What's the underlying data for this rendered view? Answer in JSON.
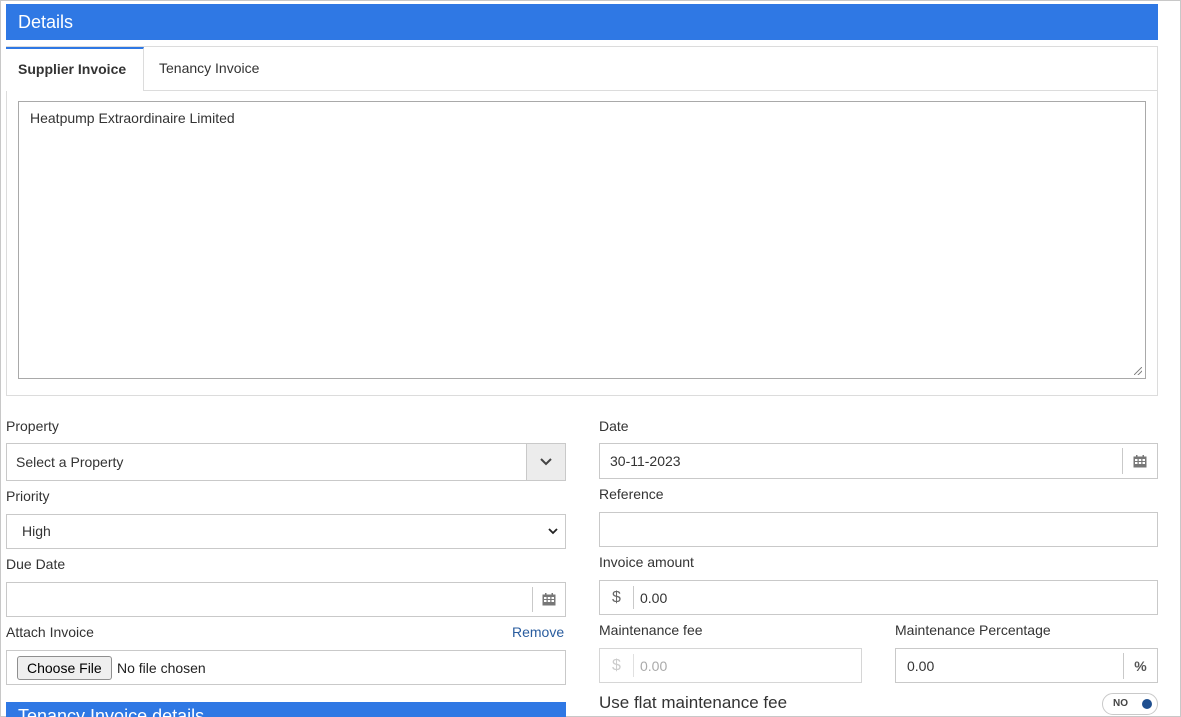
{
  "header": {
    "title": "Details"
  },
  "tabs": [
    {
      "label": "Supplier Invoice",
      "active": true
    },
    {
      "label": "Tenancy Invoice",
      "active": false
    }
  ],
  "notes": {
    "value": "Heatpump Extraordinaire Limited"
  },
  "left": {
    "property": {
      "label": "Property",
      "value": "Select a Property",
      "icon": "chevron-down-icon"
    },
    "priority": {
      "label": "Priority",
      "value": "High",
      "options": [
        "High"
      ]
    },
    "due_date": {
      "label": "Due Date",
      "value": "",
      "icon": "calendar-icon"
    },
    "attach": {
      "label": "Attach Invoice",
      "remove_label": "Remove",
      "button_label": "Choose File",
      "file_status": "No file chosen"
    },
    "section_bar": {
      "title": "Tenancy Invoice details"
    }
  },
  "right": {
    "date": {
      "label": "Date",
      "value": "30-11-2023",
      "icon": "calendar-icon"
    },
    "reference": {
      "label": "Reference",
      "value": ""
    },
    "invoice_amount": {
      "label": "Invoice amount",
      "currency": "$",
      "value": "0.00"
    },
    "maintenance_fee": {
      "label": "Maintenance fee",
      "currency": "$",
      "value": "0.00"
    },
    "maintenance_percentage": {
      "label": "Maintenance Percentage",
      "value": "0.00",
      "suffix": "%"
    },
    "flat_fee": {
      "label": "Use flat maintenance fee",
      "toggle_label": "NO",
      "on": false
    }
  },
  "colors": {
    "accent": "#2f78e4",
    "link": "#2a5d9f",
    "border": "#c9c9c9"
  }
}
